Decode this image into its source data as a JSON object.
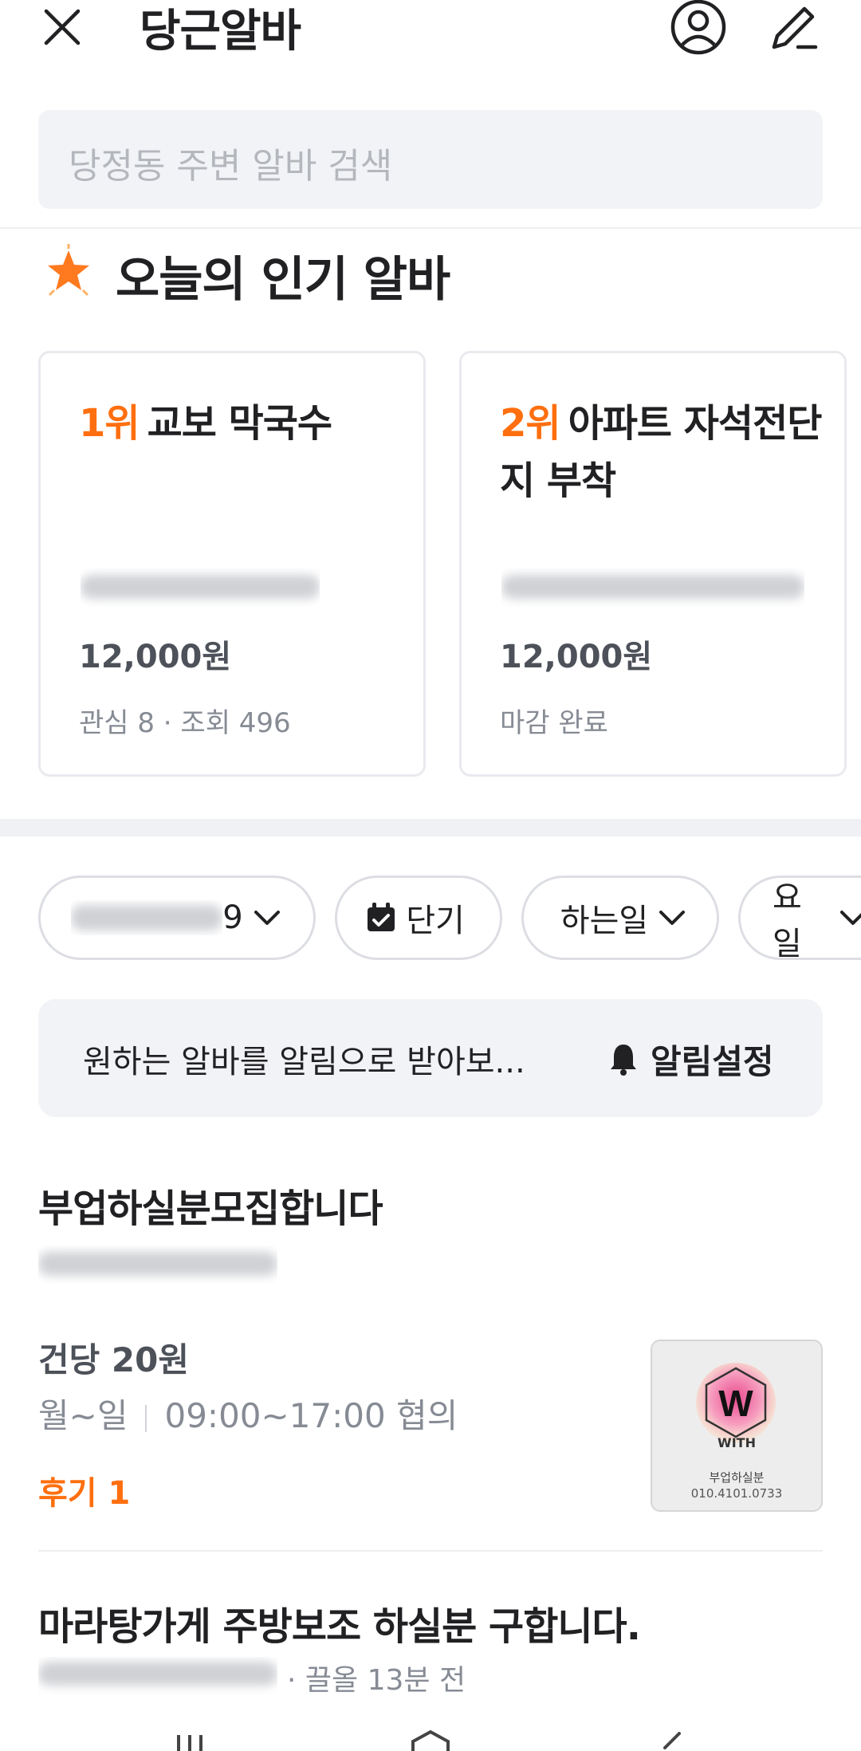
{
  "header": {
    "title": "당근알바",
    "search_placeholder": "당정동 주변 알바 검색"
  },
  "popular": {
    "title": "오늘의 인기 알바",
    "cards": [
      {
        "rank": "1위",
        "title": "교보 막국수",
        "price": "12,000원",
        "meta": "관심 8 · 조회 496"
      },
      {
        "rank": "2위",
        "title": "아파트 자석전단지 부착",
        "price": "12,000원",
        "meta": "마감 완료"
      }
    ]
  },
  "filters": {
    "chips": [
      {
        "label": "9",
        "icon": "chevron-down-icon"
      },
      {
        "label": "단기",
        "icon": "calendar-check-icon"
      },
      {
        "label": "하는일",
        "icon": "chevron-down-icon"
      },
      {
        "label": "요일",
        "icon": "chevron-down-icon"
      }
    ]
  },
  "notify": {
    "text": "원하는 알바를 알림으로 받아보...",
    "button": "알림설정"
  },
  "listings": [
    {
      "title": "부업하실분모집합니다",
      "pay": "건당 20원",
      "days": "월~일",
      "hours": "09:00~17:00 협의",
      "review": "후기 1",
      "thumb": {
        "logo_letter": "W",
        "brand": "WITH",
        "sub": "부업하실분",
        "phone": "010.4101.0733"
      }
    },
    {
      "title": "마라탕가게 주방보조 하실분 구합니다.",
      "meta": "· 끌올 13분 전"
    }
  ],
  "colors": {
    "accent": "#ff6f0f",
    "text": "#212124",
    "muted": "#868b94",
    "surface": "#f2f3f6"
  }
}
